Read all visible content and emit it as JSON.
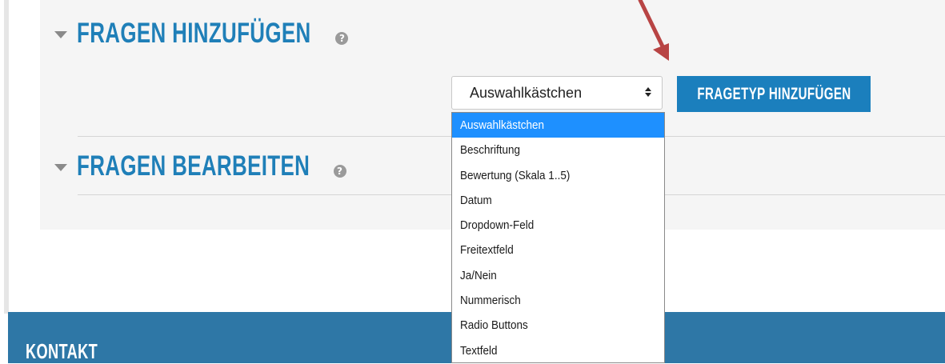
{
  "sections": {
    "add": {
      "title": "FRAGEN HINZUFÜGEN",
      "help": "?"
    },
    "edit": {
      "title": "FRAGEN BEARBEITEN",
      "help": "?"
    }
  },
  "question_type_select": {
    "selected": "Auswahlkästchen",
    "options": [
      "Auswahlkästchen",
      "Beschriftung",
      "Bewertung (Skala 1..5)",
      "Datum",
      "Dropdown-Feld",
      "Freitextfeld",
      "Ja/Nein",
      "Nummerisch",
      "Radio Buttons",
      "Textfeld"
    ]
  },
  "add_button_label": "FRAGETYP HINZUFÜGEN",
  "footer": {
    "title": "KONTAKT"
  },
  "colors": {
    "accent": "#1b7fbd",
    "heading": "#1f7fb8",
    "footer_bg": "#2e77a6",
    "selection": "#1e90ff",
    "annotation_arrow": "#b84444"
  }
}
